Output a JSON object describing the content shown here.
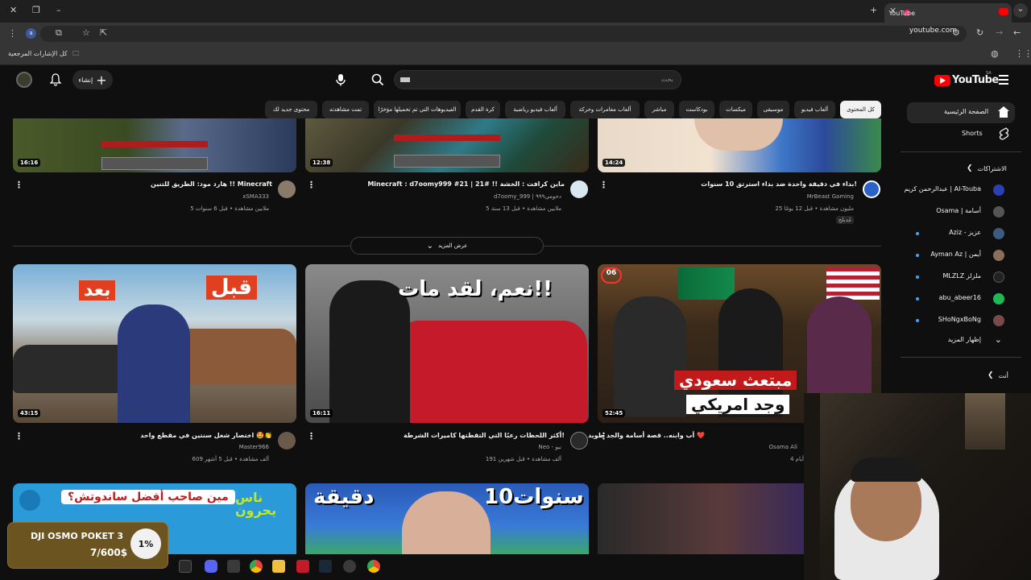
{
  "browser": {
    "tab_title": "YouTube",
    "url": "youtube.com",
    "bookmarks_label": "كل الإشارات المرجعية",
    "profile_initial": "a"
  },
  "header": {
    "logo_text": "YouTube",
    "logo_region": "SA",
    "search_placeholder": "بحث",
    "create_label": "إنشاء"
  },
  "chips": [
    "كل المحتوى",
    "ألعاب فيديو",
    "موسيقى",
    "ميكسات",
    "بودكاست",
    "مباشر",
    "ألعاب مغامرات وحركة",
    "ألعاب فيديو رياضية",
    "كرة القدم",
    "الفيديوهات التي تم تحميلها مؤخرًا",
    "تمت مشاهدته",
    "محتوى جديد لك"
  ],
  "sidebar": {
    "home": "الصفحة الرئيسية",
    "shorts": "Shorts",
    "subscriptions_header": "الاشتراكات",
    "subscriptions": [
      {
        "name": "عبدالرحمن كريم | Al-Touba",
        "color": "#2b3fb0",
        "live": false
      },
      {
        "name": "Osama | أسامة",
        "color": "#555555",
        "live": false
      },
      {
        "name": "Aziz - عزيز",
        "color": "#3d5a80",
        "live": true
      },
      {
        "name": "Ayman Az | أيمن",
        "color": "#8a6d5b",
        "live": true
      },
      {
        "name": "MLZLZ ملزلز",
        "color": "#222222",
        "live": true
      },
      {
        "name": "abu_abeer16",
        "color": "#1db954",
        "live": true
      },
      {
        "name": "SHoNgxBoNg",
        "color": "#7a4a4a",
        "live": true
      }
    ],
    "show_more": "إظهار المزيد",
    "you_header": "أنت"
  },
  "row1": [
    {
      "title": "بداء في دقيقة واحدة ضد بداء استرتق 10 سنوات!",
      "channel": "MrBeast Gaming",
      "meta": "25 مليون مشاهدة • قبل 12 يومًا",
      "badge": "مُدبلج",
      "duration": "14:24"
    },
    {
      "title": "Minecraft : d7oomy999 #21 | ماين كرافت : الخشة !! #21",
      "channel": "d7oomy_999 | دحومي٩٩٩",
      "meta": "5 ملايين مشاهدة • قبل 13 سنة",
      "duration": "12:38"
    },
    {
      "title": "هارد مود: الطريق للتنين !! Minecraft",
      "channel": "xSMA333",
      "meta": "5 ملايين مشاهدة • قبل 6 سنوات",
      "duration": "16:16"
    }
  ],
  "show_more_label": "عرض المزيد",
  "row2": [
    {
      "title": "أب وابنه.. قصة أسامة والجد طويد ❤️",
      "channel": "Osama Ali",
      "meta": "4 أيام",
      "duration": "52:45",
      "thumb_text_1": "مبتعث سعودي",
      "thumb_text_2": "وجد امريكي"
    },
    {
      "title": "أكثر اللحظات رعبًا التي التقطتها كاميرات الشرطة!",
      "channel": "Neo - نيو",
      "meta": "191 ألف مشاهدة • قبل شهرين",
      "duration": "16:11",
      "thumb_text_1": "نعم، لقد مات!!"
    },
    {
      "title": "اختصار شغل سنتين في مقطع واحد 🤩👏",
      "channel": "Master966",
      "meta": "609 ألف مشاهدة • قبل 5 أشهر",
      "duration": "43:15",
      "thumb_text_1": "قبل",
      "thumb_text_2": "بعد"
    }
  ],
  "row3": [
    {
      "thumb_text_1": "10سنوات",
      "thumb_text_2": "دقيقة"
    },
    {
      "thumb_text_1": "مين صاحب أفضل ساندوتش؟",
      "thumb_text_2": "ناس يحرون"
    }
  ],
  "goal": {
    "title": "DJI OSMO POKET 3",
    "count": "7/600$",
    "percent": "1%"
  },
  "colors": {
    "yt_red": "#ff0000",
    "bg": "#0f0f0f",
    "chip": "#272727"
  }
}
